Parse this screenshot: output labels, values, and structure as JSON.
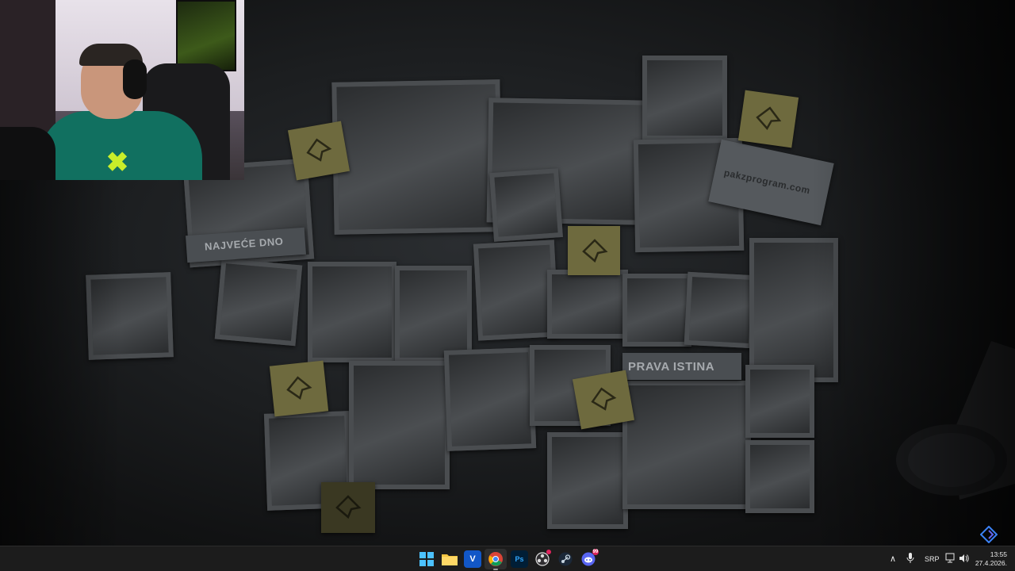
{
  "wallpaper": {
    "captions": [
      "NAJVEĆE DNO",
      "PRAVA ISTINA"
    ],
    "url_note": "pakzprogram.com"
  },
  "taskbar": {
    "apps": [
      {
        "name": "Start",
        "icon": "windows-icon"
      },
      {
        "name": "File Explorer",
        "icon": "folder-icon"
      },
      {
        "name": "Vegas",
        "icon": "v-app-icon"
      },
      {
        "name": "Google Chrome",
        "icon": "chrome-icon",
        "active": true
      },
      {
        "name": "Photoshop",
        "icon": "photoshop-icon",
        "label": "Ps"
      },
      {
        "name": "OBS",
        "icon": "obs-icon"
      },
      {
        "name": "Steam",
        "icon": "steam-icon"
      },
      {
        "name": "Discord",
        "icon": "discord-icon",
        "badge": "99"
      }
    ],
    "tray": {
      "language": "SRP",
      "time": "13:55",
      "date": "27.4.2026."
    }
  },
  "colors": {
    "taskbar_bg": "#1c1c1c",
    "shirt": "#117060",
    "logo_accent": "#c8ee2a",
    "sticky_note": "#6e6a3e"
  }
}
